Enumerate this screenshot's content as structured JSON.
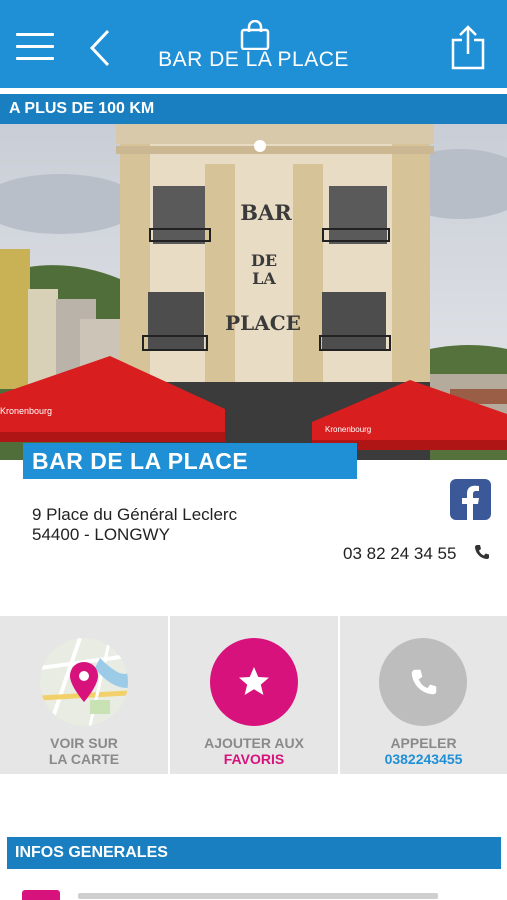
{
  "header": {
    "title": "BAR DE LA PLACE",
    "icons": [
      "menu-icon",
      "back-icon",
      "shopping-bag-icon",
      "share-icon"
    ],
    "background": "#1f8fd6"
  },
  "distance_label": "A PLUS DE 100 KM",
  "photo": {
    "sign_lines": [
      "BAR",
      "DE",
      "LA",
      "PLACE"
    ],
    "umbrella_brand": "Kronenbourg"
  },
  "venue_name": "BAR DE LA PLACE",
  "address": {
    "line1": "9 Place du Général Leclerc",
    "line2": "54400 - LONGWY"
  },
  "phone": "03 82 24 34 55",
  "actions": [
    {
      "label1": "VOIR SUR",
      "label2": "LA CARTE",
      "icon": "map-pin-icon",
      "color": "#d8127d"
    },
    {
      "label1": "AJOUTER AUX",
      "label2": "FAVORIS",
      "icon": "star-icon",
      "color": "#d8127d"
    },
    {
      "label1": "APPELER",
      "label2": "0382243455",
      "icon": "phone-icon",
      "color": "#1f8fd6"
    }
  ],
  "infos_title": "INFOS GENERALES",
  "colors": {
    "primary": "#1f8fd6",
    "primary_dark": "#1a7fc0",
    "accent": "#d8127d",
    "tile_bg": "#e6e6e6"
  }
}
